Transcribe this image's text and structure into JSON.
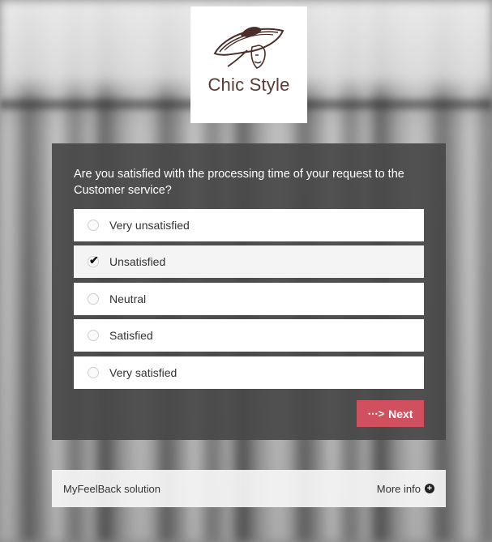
{
  "brand": {
    "name": "Chic Style",
    "color": "#5a3a35"
  },
  "survey": {
    "question": "Are you satisfied with the processing time of your request to the Customer service?",
    "options": [
      {
        "label": "Very unsatisfied",
        "selected": false
      },
      {
        "label": "Unsatisfied",
        "selected": true
      },
      {
        "label": "Neutral",
        "selected": false
      },
      {
        "label": "Satisfied",
        "selected": false
      },
      {
        "label": "Very satisfied",
        "selected": false
      }
    ],
    "selected_mark": "✔",
    "next_label": "Next",
    "next_icon": "dotted-arrow-right-icon",
    "accent": "#d0505f"
  },
  "footer": {
    "left_text": "MyFeelBack solution",
    "more_info_label": "More info",
    "more_info_icon": "plus-circle-icon"
  }
}
